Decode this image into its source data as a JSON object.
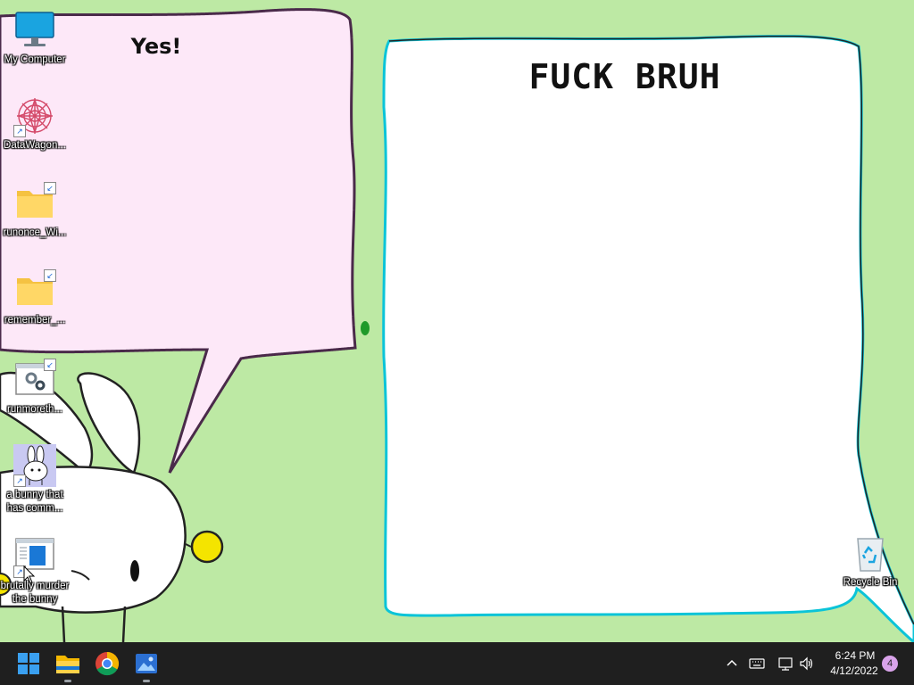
{
  "wallpaper": {
    "pink_bubble_text": "Yes!",
    "white_bubble_text": "FUCK BRUH"
  },
  "desktop_icons": [
    {
      "label": "My Computer",
      "icon": "monitor-icon"
    },
    {
      "label": "DataWagon...",
      "icon": "mandala-icon",
      "shortcut": true
    },
    {
      "label": "runonce_Wi...",
      "icon": "folder-icon",
      "shortcut": true
    },
    {
      "label": "remember_...",
      "icon": "folder-icon",
      "shortcut": true
    },
    {
      "label": "runmoreth...",
      "icon": "settings-window-icon",
      "shortcut": true
    },
    {
      "label": "a bunny that has comm...",
      "icon": "bunny-icon",
      "shortcut": true
    },
    {
      "label": "brutally murder the bunny",
      "icon": "app-window-icon",
      "shortcut": true
    }
  ],
  "recycle_bin": {
    "label": "Recycle Bin",
    "icon": "recycle-bin-icon"
  },
  "taskbar": {
    "apps": [
      "start-icon",
      "file-explorer-icon",
      "chrome-icon",
      "photos-icon"
    ],
    "clock_time": "6:24 PM",
    "clock_date": "4/12/2022",
    "notification_count": "4"
  },
  "colors": {
    "background": "#bde9a4",
    "pink_bubble": "#fde8f8",
    "taskbar": "#1f1f1f",
    "accent": "#0078d4"
  }
}
